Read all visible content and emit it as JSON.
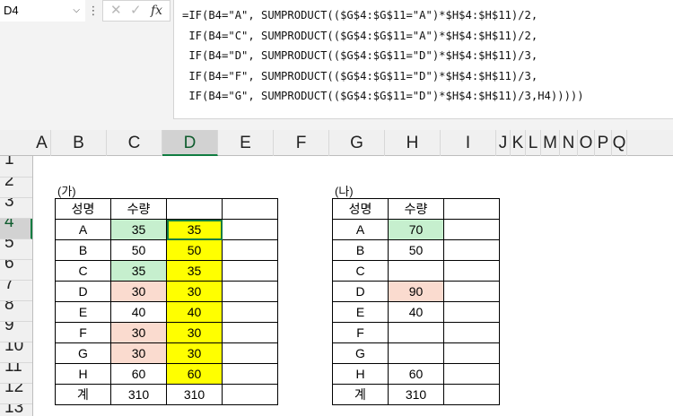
{
  "name_box": "D4",
  "formula_bar": {
    "lines": [
      "=IF(B4=\"A\", SUMPRODUCT(($G$4:$G$11=\"A\")*$H$4:$H$11)/2,",
      " IF(B4=\"C\", SUMPRODUCT(($G$4:$G$11=\"A\")*$H$4:$H$11)/2,",
      " IF(B4=\"D\", SUMPRODUCT(($G$4:$G$11=\"D\")*$H$4:$H$11)/3,",
      " IF(B4=\"F\", SUMPRODUCT(($G$4:$G$11=\"D\")*$H$4:$H$11)/3,",
      " IF(B4=\"G\", SUMPRODUCT(($G$4:$G$11=\"D\")*$H$4:$H$11)/3,H4)))))"
    ],
    "dots": "⋮",
    "cancel": "✕",
    "enter": "✓",
    "fx": "fx"
  },
  "columns": [
    "A",
    "B",
    "C",
    "D",
    "E",
    "F",
    "G",
    "H",
    "I",
    "J",
    "K",
    "L",
    "M",
    "N",
    "O",
    "P",
    "Q"
  ],
  "selected_column": "D",
  "rows": [
    "1",
    "2",
    "3",
    "4",
    "5",
    "6",
    "7",
    "8",
    "9",
    "10",
    "11",
    "12",
    "13"
  ],
  "selected_row": "4",
  "table_ga": {
    "caption": "(가)",
    "header": [
      "성명",
      "수량",
      ""
    ],
    "rows": [
      {
        "name": "A",
        "qty": "35",
        "res": "35",
        "qty_fill": "g"
      },
      {
        "name": "B",
        "qty": "50",
        "res": "50",
        "qty_fill": ""
      },
      {
        "name": "C",
        "qty": "35",
        "res": "35",
        "qty_fill": "g"
      },
      {
        "name": "D",
        "qty": "30",
        "res": "30",
        "qty_fill": "p"
      },
      {
        "name": "E",
        "qty": "40",
        "res": "40",
        "qty_fill": ""
      },
      {
        "name": "F",
        "qty": "30",
        "res": "30",
        "qty_fill": "p"
      },
      {
        "name": "G",
        "qty": "30",
        "res": "30",
        "qty_fill": "p"
      },
      {
        "name": "H",
        "qty": "60",
        "res": "60",
        "qty_fill": ""
      }
    ],
    "total": {
      "name": "계",
      "qty": "310",
      "res": "310"
    }
  },
  "table_na": {
    "caption": "(나)",
    "header": [
      "성명",
      "수량",
      ""
    ],
    "rows": [
      {
        "name": "A",
        "qty": "70",
        "qty_fill": "g"
      },
      {
        "name": "B",
        "qty": "50",
        "qty_fill": ""
      },
      {
        "name": "C",
        "qty": "",
        "qty_fill": ""
      },
      {
        "name": "D",
        "qty": "90",
        "qty_fill": "p"
      },
      {
        "name": "E",
        "qty": "40",
        "qty_fill": ""
      },
      {
        "name": "F",
        "qty": "",
        "qty_fill": ""
      },
      {
        "name": "G",
        "qty": "",
        "qty_fill": ""
      },
      {
        "name": "H",
        "qty": "60",
        "qty_fill": ""
      }
    ],
    "total": {
      "name": "계",
      "qty": "310"
    }
  },
  "colors": {
    "green_fill": "#c6efce",
    "pink_fill": "#fadbcf",
    "yellow_fill": "#ffff00",
    "selection_accent": "#107c41"
  }
}
